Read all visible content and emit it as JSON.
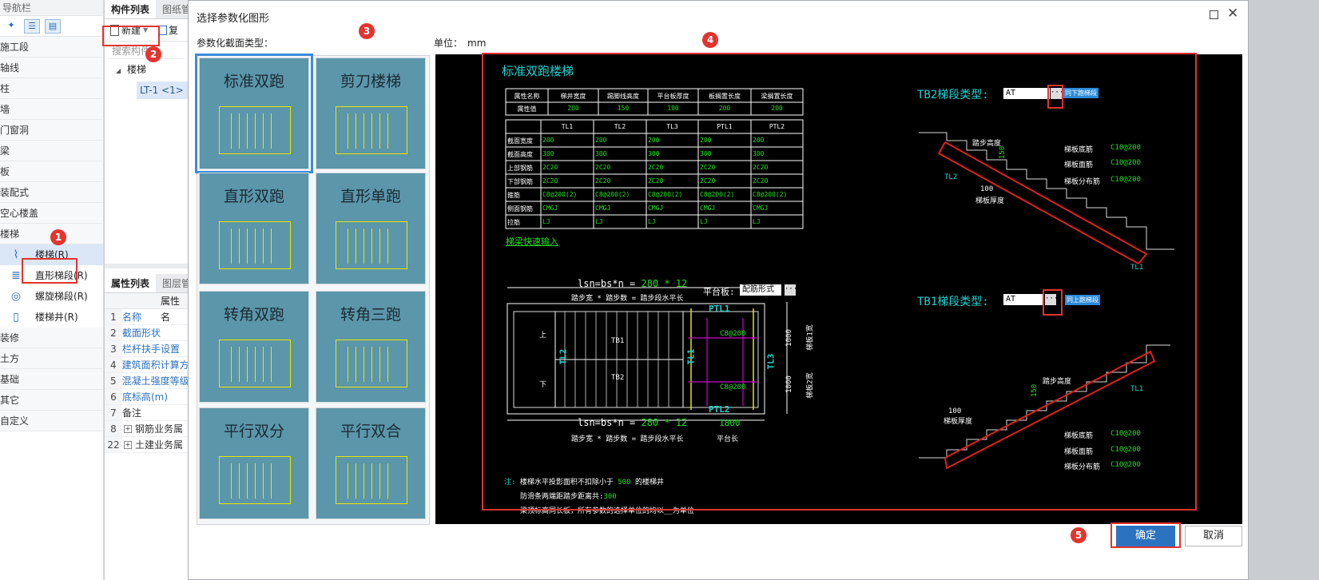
{
  "nav": {
    "title": "导航栏",
    "groups": [
      "施工段",
      "轴线",
      "柱",
      "墙",
      "门窗洞",
      "梁",
      "板",
      "装配式",
      "空心楼盖",
      "楼梯"
    ],
    "stair_items": [
      "楼梯(R)",
      "直形梯段(R)",
      "螺旋梯段(R)",
      "楼梯井(R)"
    ],
    "groups2": [
      "装修",
      "土方",
      "基础",
      "其它",
      "自定义"
    ]
  },
  "mid": {
    "tab1": "构件列表",
    "tab2": "图纸管",
    "new_label": "新建",
    "copy_label": "复",
    "search": "搜索构件",
    "tree_root": "楼梯",
    "tree_item": "LT-1 <1>",
    "prop_tab1": "属性列表",
    "prop_tab2": "图层管",
    "prop_header": "属性名",
    "props": [
      {
        "no": "1",
        "name": "名称"
      },
      {
        "no": "2",
        "name": "截面形状"
      },
      {
        "no": "3",
        "name": "栏杆扶手设置"
      },
      {
        "no": "4",
        "name": "建筑面积计算方"
      },
      {
        "no": "5",
        "name": "混凝土强度等级"
      },
      {
        "no": "6",
        "name": "底标高(m)"
      },
      {
        "no": "7",
        "name": "备注"
      },
      {
        "no": "8",
        "name": "钢筋业务属"
      },
      {
        "no": "22",
        "name": "土建业务属"
      }
    ]
  },
  "dialog": {
    "title": "选择参数化图形",
    "type_label": "参数化截面类型：",
    "unit_label": "单位：",
    "unit": "mm",
    "ok": "确定",
    "cancel": "取消",
    "shapes": [
      "标准双跑",
      "剪刀楼梯",
      "直形双跑",
      "直形单跑",
      "转角双跑",
      "转角三跑",
      "平行双分",
      "平行双合"
    ]
  },
  "cad": {
    "title": "标准双跑楼梯",
    "attr_header": [
      "属性名称",
      "梯井宽度",
      "踢脚线高度",
      "平台板厚度",
      "板搁置长度",
      "梁搁置长度"
    ],
    "attr_row": [
      "属性值",
      "200",
      "150",
      "100",
      "200",
      "200"
    ],
    "beam_header": [
      "",
      "TL1",
      "TL2",
      "TL3",
      "PTL1",
      "PTL2"
    ],
    "beam_rows": [
      [
        "截面宽度",
        "200",
        "200",
        "200",
        "200",
        "200"
      ],
      [
        "截面高度",
        "300",
        "300",
        "300",
        "300",
        "300"
      ],
      [
        "上部钢筋",
        "2C20",
        "2C20",
        "2C20",
        "2C20",
        "2C20"
      ],
      [
        "下部钢筋",
        "2C20",
        "2C20",
        "2C20",
        "2C20",
        "2C20"
      ],
      [
        "箍筋",
        "C8@200(2)",
        "C8@200(2)",
        "C8@200(2)",
        "C8@200(2)",
        "C8@200(2)"
      ],
      [
        "侧面钢筋",
        "CMGJ",
        "CMGJ",
        "CMGJ",
        "CMGJ",
        "CMGJ"
      ],
      [
        "拉筋",
        "LJ",
        "LJ",
        "LJ",
        "LJ",
        "LJ"
      ]
    ],
    "quick": "梯梁快速输入",
    "tb2_label": "TB2梯段类型:",
    "tb2_value": "AT",
    "tb2_link": "同下跑梯段",
    "tb1_label": "TB1梯段类型:",
    "tb1_value": "AT",
    "tb1_link": "同上跑梯段",
    "formula_pre": "lsn=bs*n = ",
    "formula_val": "280 * 12",
    "formula_note": "踏步宽 * 踏步数 = 踏步段水平长",
    "platform_label": "平台板:",
    "platform_value": "配筋形式",
    "platform_len": "1800",
    "platform_note": "平台长",
    "rebar": "C8@200",
    "tl1": "TL1",
    "tl2": "TL2",
    "tl3": "TL3",
    "ptl1": "PTL1",
    "ptl2": "PTL2",
    "tb1": "TB1",
    "tb2": "TB2",
    "up": "上",
    "down": "下",
    "dim1000": "1000",
    "w1": "梯板1宽",
    "w2": "梯板2宽",
    "step_h": "踏步高度",
    "step_150": "150",
    "slab_t": "梯板厚度",
    "slab_100": "100",
    "bottom_bar": "梯板底筋",
    "top_bar": "梯板面筋",
    "dist_bar": "梯板分布筋",
    "c10": "C10@200",
    "note_prefix": "注:",
    "note1_pre": "楼梯水平投影面积不扣除小于 ",
    "note1_val": "500",
    "note1_post": " 的楼梯井",
    "note2_pre": "防滑条两端距踏步距离共:",
    "note2_val": "300",
    "note3": "梁顶标高同长板，所有参数的选择单位的均以__为单位"
  },
  "badges": [
    "1",
    "2",
    "3",
    "4",
    "5"
  ],
  "colors": {
    "accent": "#2b72c0",
    "highlight": "#e3342f",
    "cad_bg": "#000000",
    "tile": "#5b96aa"
  }
}
